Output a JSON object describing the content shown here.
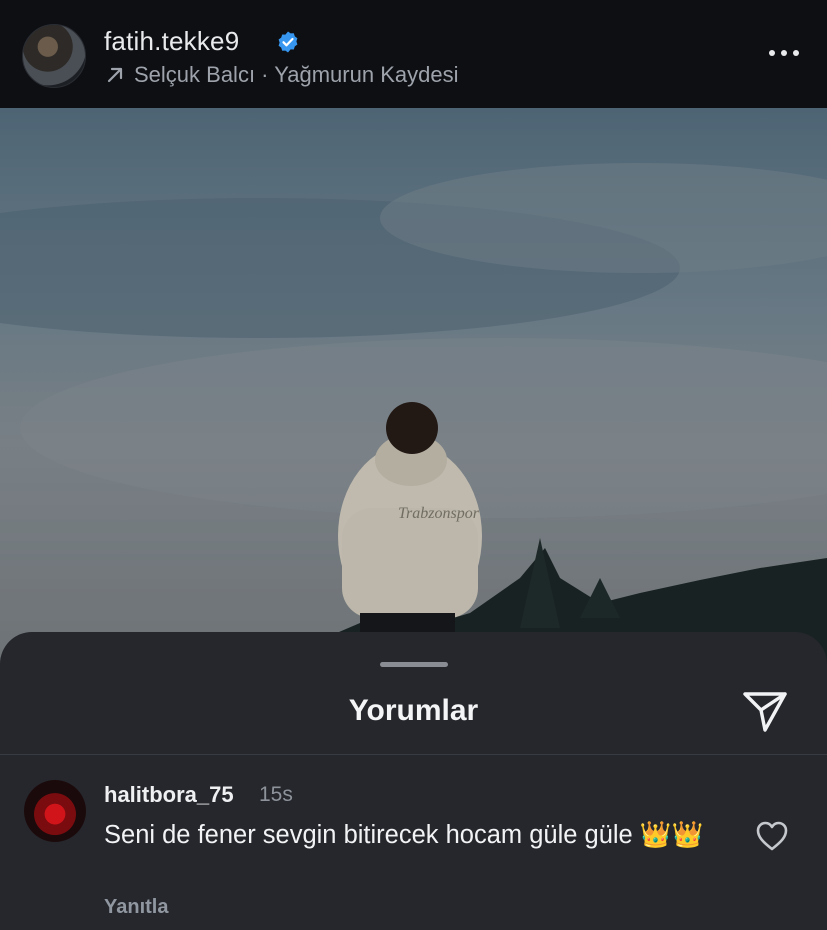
{
  "header": {
    "username": "fatih.tekke9",
    "verified": true,
    "music_label": "Selçuk Balcı · Yağmurun Kaydesi",
    "icons": {
      "verified": "verified-badge-icon",
      "music": "arrow-up-right-icon",
      "more": "more-horizontal-icon"
    }
  },
  "photo": {
    "description_icon": "photo"
  },
  "comments_sheet": {
    "title": "Yorumlar",
    "share_icon": "send-icon",
    "comments": [
      {
        "username": "halitbora_75",
        "time": "15s",
        "text": "Seni de fener sevgin bitirecek hocam güle güle 👑👑",
        "reply_label": "Yanıtla",
        "like_icon": "heart-icon"
      }
    ]
  },
  "colors": {
    "background": "#0f1116",
    "sheet": "#25272c",
    "verified": "#3797f0",
    "muted_text": "#9ea3ab"
  }
}
